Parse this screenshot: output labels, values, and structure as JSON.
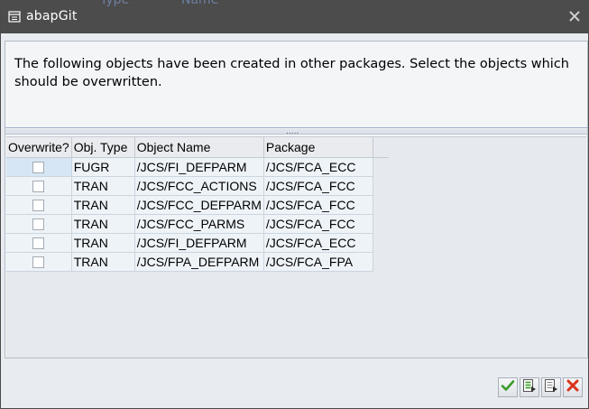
{
  "window": {
    "title": "abapGit",
    "background_ghost_1": "Type",
    "background_ghost_2": "Name"
  },
  "message": {
    "text": "The following objects have been created in other packages. Select the objects which should be overwritten."
  },
  "splitter": {
    "grip": "....."
  },
  "grid": {
    "headers": {
      "overwrite": "Overwrite?",
      "obj_type": "Obj. Type",
      "object_name": "Object Name",
      "package": "Package"
    },
    "rows": [
      {
        "overwrite": false,
        "obj_type": "FUGR",
        "object_name": "/JCS/FI_DEFPARM",
        "package": "/JCS/FCA_ECC"
      },
      {
        "overwrite": false,
        "obj_type": "TRAN",
        "object_name": "/JCS/FCC_ACTIONS",
        "package": "/JCS/FCA_FCC"
      },
      {
        "overwrite": false,
        "obj_type": "TRAN",
        "object_name": "/JCS/FCC_DEFPARM",
        "package": "/JCS/FCA_FCC"
      },
      {
        "overwrite": false,
        "obj_type": "TRAN",
        "object_name": "/JCS/FCC_PARMS",
        "package": "/JCS/FCA_FCC"
      },
      {
        "overwrite": false,
        "obj_type": "TRAN",
        "object_name": "/JCS/FI_DEFPARM",
        "package": "/JCS/FCA_ECC"
      },
      {
        "overwrite": false,
        "obj_type": "TRAN",
        "object_name": "/JCS/FPA_DEFPARM",
        "package": "/JCS/FCA_FPA"
      }
    ]
  },
  "footer": {
    "buttons": [
      "confirm-icon",
      "select-all-icon",
      "deselect-all-icon",
      "cancel-icon"
    ]
  },
  "colors": {
    "titlebar": "#4c4c4c",
    "confirm_green": "#3a9a2a",
    "cancel_red": "#d9341c"
  }
}
